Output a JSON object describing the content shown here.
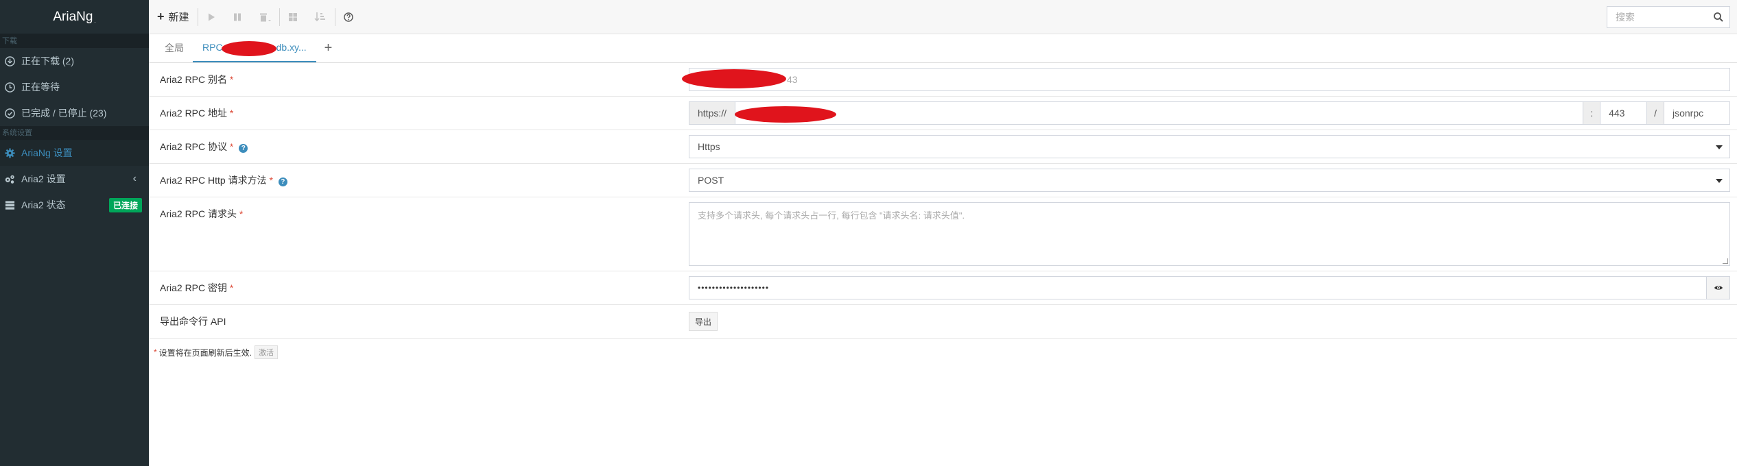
{
  "brand": {
    "name": "AriaNg",
    "suffix": "."
  },
  "sidebar": {
    "section_download": "下载",
    "section_settings": "系统设置",
    "items": [
      {
        "label": "正在下载 (2)",
        "icon": "download-circle-icon"
      },
      {
        "label": "正在等待",
        "icon": "clock-icon"
      },
      {
        "label": "已完成 / 已停止 (23)",
        "icon": "check-circle-icon"
      },
      {
        "label": "AriaNg 设置",
        "icon": "gear-icon"
      },
      {
        "label": "Aria2 设置",
        "icon": "gears-icon",
        "chevron": "‹"
      },
      {
        "label": "Aria2 状态",
        "icon": "server-icon",
        "badge": "已连接"
      }
    ]
  },
  "toolbar": {
    "new_label": "新建",
    "search_placeholder": "搜索"
  },
  "tabs": {
    "global": "全局",
    "rpc_prefix": "RPC",
    "rpc_suffix": "db.xy...",
    "add": "+"
  },
  "form": {
    "alias_label": "Aria2 RPC 别名",
    "alias_value": "43",
    "address_label": "Aria2 RPC 地址",
    "address_protocol": "https://",
    "address_colon": ":",
    "address_port": "443",
    "address_slash": "/",
    "address_interface": "jsonrpc",
    "protocol_label": "Aria2 RPC 协议",
    "protocol_value": "Https",
    "method_label": "Aria2 RPC Http 请求方法",
    "method_value": "POST",
    "headers_label": "Aria2 RPC 请求头",
    "headers_placeholder": "支持多个请求头, 每个请求头占一行, 每行包含 \"请求头名: 请求头值\".",
    "secret_label": "Aria2 RPC 密钥",
    "secret_value": "••••••••••••••••••••",
    "export_label": "导出命令行 API",
    "export_button": "导出",
    "required_mark": "*",
    "help_mark": "?"
  },
  "note": {
    "text": "设置将在页面刷新后生效.",
    "activate": "激活"
  },
  "colors": {
    "sidebar_bg": "#222d32",
    "accent": "#3c8dbc",
    "badge_green": "#00a65a",
    "required_red": "#dd4b39"
  }
}
